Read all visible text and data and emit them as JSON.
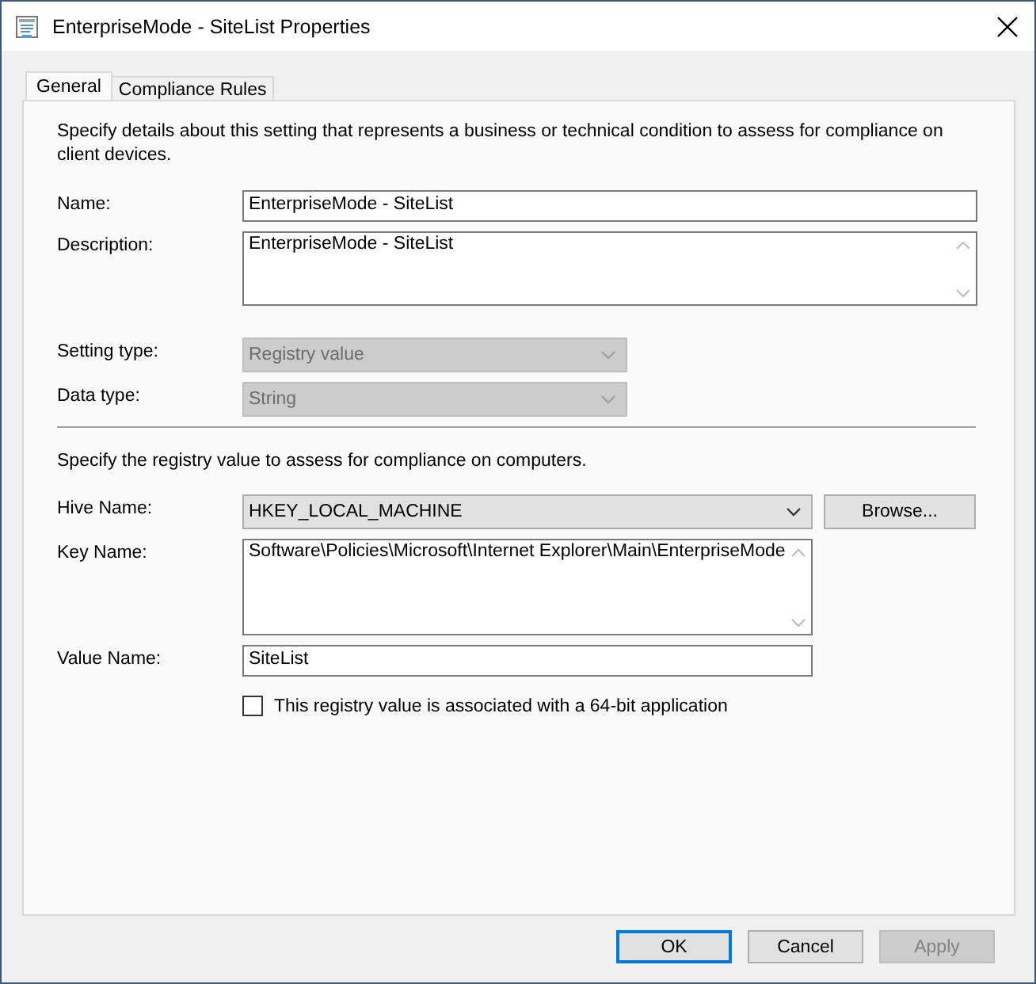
{
  "window": {
    "title": "EnterpriseMode - SiteList Properties"
  },
  "tabs": [
    {
      "label": "General",
      "selected": true
    },
    {
      "label": "Compliance Rules",
      "selected": false
    }
  ],
  "intro": "Specify details about this setting that represents a business or technical condition to assess for compliance on client devices.",
  "setting_fields": [
    {
      "kind": "text",
      "label": "Name:",
      "value": "EnterpriseMode - SiteList"
    },
    {
      "kind": "multiline",
      "label": "Description:",
      "value": "EnterpriseMode - SiteList"
    },
    {
      "kind": "spacer"
    },
    {
      "kind": "dropdown",
      "label": "Setting type:",
      "value": "Registry value",
      "disabled": true
    },
    {
      "kind": "dropdown",
      "label": "Data type:",
      "value": "String",
      "disabled": true
    }
  ],
  "registry_intro": "Specify the registry value to assess for compliance on computers.",
  "registry_fields": [
    {
      "kind": "dropdown",
      "label": "Hive Name:",
      "value": "HKEY_LOCAL_MACHINE",
      "disabled": false,
      "button": "Browse..."
    },
    {
      "kind": "multiline",
      "label": "Key Name:",
      "value": "Software\\Policies\\Microsoft\\Internet Explorer\\Main\\EnterpriseMode"
    },
    {
      "kind": "text",
      "label": "Value Name:",
      "value": "SiteList"
    }
  ],
  "checkbox": {
    "label": "This registry value is associated with a 64-bit application",
    "checked": false
  },
  "buttons": [
    {
      "label": "OK",
      "default": true,
      "disabled": false
    },
    {
      "label": "Cancel",
      "default": false,
      "disabled": false
    },
    {
      "label": "Apply",
      "default": false,
      "disabled": true
    }
  ]
}
